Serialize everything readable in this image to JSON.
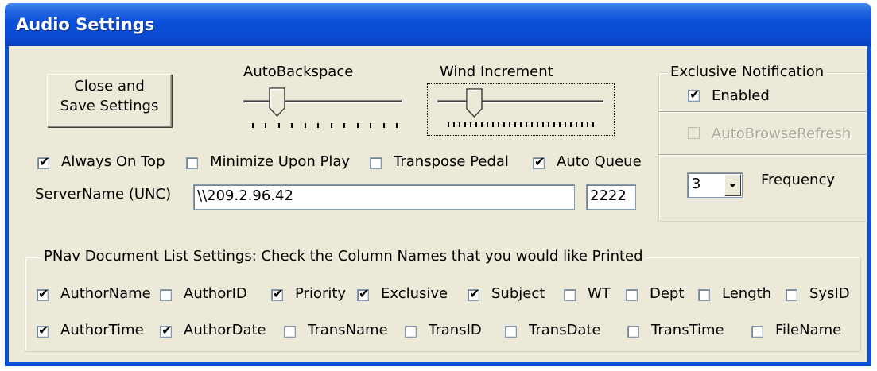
{
  "window": {
    "title": "Audio Settings"
  },
  "buttons": {
    "close_save_line1": "Close and",
    "close_save_line2": "Save Settings"
  },
  "sliders": {
    "autobackspace": {
      "label": "AutoBackspace",
      "level": 0.2
    },
    "wind_increment": {
      "label": "Wind Increment",
      "level": 0.2
    }
  },
  "exclusive_notification": {
    "title": "Exclusive Notification",
    "enabled_label": "Enabled",
    "enabled_checked": true,
    "autobrowse_label": "AutoBrowseRefresh",
    "autobrowse_checked": false,
    "frequency_label": "Frequency",
    "frequency_value": "3"
  },
  "options": [
    {
      "label": "Always On Top",
      "checked": true
    },
    {
      "label": "Minimize Upon Play",
      "checked": false
    },
    {
      "label": "Transpose Pedal",
      "checked": false
    },
    {
      "label": "Auto Queue",
      "checked": true
    }
  ],
  "server": {
    "label": "ServerName (UNC)",
    "address": "\\\\209.2.96.42",
    "port": "2222"
  },
  "columns_group": {
    "title": "PNav Document List Settings:  Check the Column Names that you would like Printed",
    "row1": [
      {
        "label": "AuthorName",
        "checked": true
      },
      {
        "label": "AuthorID",
        "checked": false
      },
      {
        "label": "Priority",
        "checked": true
      },
      {
        "label": "Exclusive",
        "checked": true
      },
      {
        "label": "Subject",
        "checked": true
      },
      {
        "label": "WT",
        "checked": false
      },
      {
        "label": "Dept",
        "checked": false
      },
      {
        "label": "Length",
        "checked": false
      },
      {
        "label": "SysID",
        "checked": false
      }
    ],
    "row2": [
      {
        "label": "AuthorTime",
        "checked": true
      },
      {
        "label": "AuthorDate",
        "checked": true
      },
      {
        "label": "TransName",
        "checked": false
      },
      {
        "label": "TransID",
        "checked": false
      },
      {
        "label": "TransDate",
        "checked": false
      },
      {
        "label": "TransTime",
        "checked": false
      },
      {
        "label": "FileName",
        "checked": false
      }
    ]
  }
}
